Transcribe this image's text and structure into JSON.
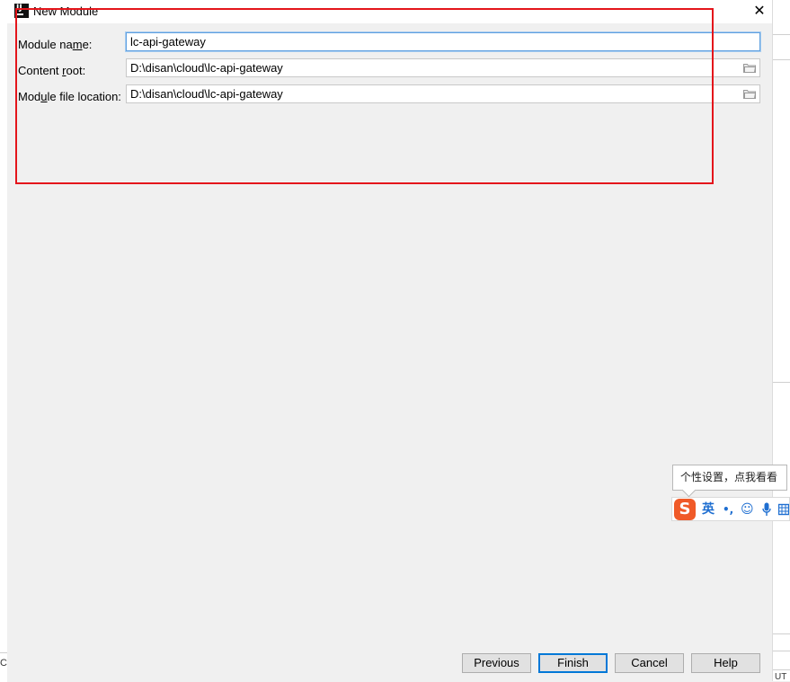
{
  "window": {
    "title": "New Module",
    "close_symbol": "✕"
  },
  "form": {
    "module_name": {
      "label_prefix": "Module na",
      "label_accel": "m",
      "label_suffix": "e:",
      "value": "lc-api-gateway"
    },
    "content_root": {
      "label_prefix": "Content ",
      "label_accel": "r",
      "label_suffix": "oot:",
      "value": "D:\\disan\\cloud\\lc-api-gateway"
    },
    "module_file_location": {
      "label_prefix": "Mod",
      "label_accel": "u",
      "label_suffix": "le file location:",
      "value": "D:\\disan\\cloud\\lc-api-gateway"
    }
  },
  "buttons": {
    "previous": "Previous",
    "finish": "Finish",
    "cancel": "Cancel",
    "help": "Help"
  },
  "ime": {
    "tooltip": "个性设置，点我看看",
    "logo": "S",
    "mode": "英",
    "punct": "•,",
    "emoji_icon": "☺",
    "mic_icon": "🎤",
    "keyboard_icon": "⌨"
  },
  "background": {
    "bottom_left_text": "C",
    "bottom_right_text": "UT"
  },
  "colors": {
    "highlight": "#e4151b",
    "focus": "#5fa0e0",
    "ime_brand": "#f05a28"
  }
}
